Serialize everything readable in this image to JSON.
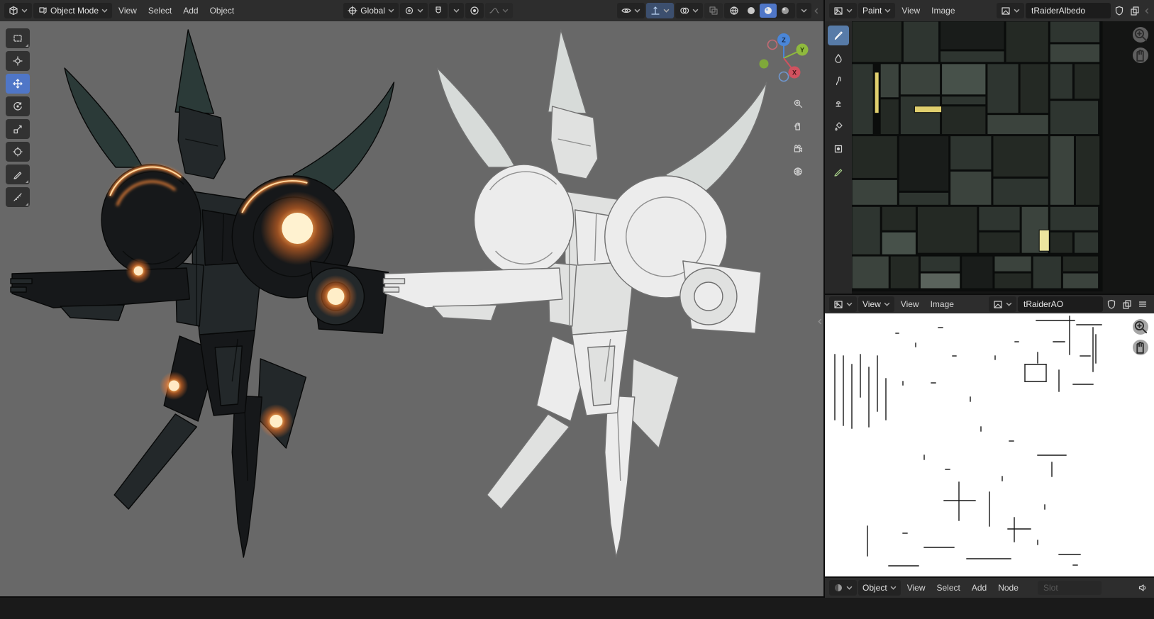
{
  "viewport": {
    "mode": "Object Mode",
    "menus": [
      "View",
      "Select",
      "Add",
      "Object"
    ],
    "orientation": "Global",
    "axis": {
      "x": "X",
      "y": "Y",
      "z": "Z"
    }
  },
  "paint_editor": {
    "mode": "Paint",
    "menus": [
      "View",
      "Image"
    ],
    "image_name": "tRaiderAlbedo"
  },
  "ao_editor": {
    "mode": "View",
    "menus": [
      "View",
      "Image"
    ],
    "image_name": "tRaiderAO"
  },
  "shader_editor": {
    "mode": "Object",
    "menus": [
      "View",
      "Select",
      "Add",
      "Node"
    ],
    "slot_label": "Slot"
  },
  "colors": {
    "accent_blue": "#4f76c7",
    "glow_orange": "#ff8c3a",
    "viewport_bg": "#686868",
    "header_bg": "#2d2d2d",
    "texture_yellow": "#e0cf6e"
  },
  "texture_palette": [
    "#0e100f",
    "#242924",
    "#2e3530",
    "#3b433d",
    "#47514a",
    "#191c1a",
    "#e0cf6e",
    "#ece59e",
    "#5a635c",
    "#0b0b0b"
  ],
  "texture_blocks": [
    [
      0,
      0,
      70,
      58,
      1
    ],
    [
      72,
      0,
      50,
      58,
      2
    ],
    [
      124,
      0,
      90,
      40,
      5
    ],
    [
      124,
      42,
      90,
      16,
      2
    ],
    [
      216,
      0,
      60,
      58,
      1
    ],
    [
      278,
      0,
      70,
      30,
      2
    ],
    [
      278,
      32,
      70,
      26,
      3
    ],
    [
      0,
      60,
      30,
      100,
      2
    ],
    [
      32,
      72,
      6,
      58,
      6
    ],
    [
      40,
      60,
      26,
      48,
      3
    ],
    [
      40,
      110,
      26,
      50,
      1
    ],
    [
      68,
      60,
      56,
      44,
      3
    ],
    [
      68,
      106,
      56,
      54,
      2
    ],
    [
      126,
      60,
      62,
      44,
      4
    ],
    [
      126,
      106,
      62,
      12,
      2
    ],
    [
      88,
      120,
      56,
      9,
      6
    ],
    [
      126,
      120,
      62,
      40,
      1
    ],
    [
      190,
      60,
      44,
      70,
      2
    ],
    [
      236,
      60,
      40,
      70,
      1
    ],
    [
      190,
      132,
      86,
      28,
      3
    ],
    [
      278,
      60,
      32,
      50,
      2
    ],
    [
      312,
      60,
      36,
      50,
      1
    ],
    [
      278,
      112,
      68,
      48,
      2
    ],
    [
      0,
      162,
      64,
      60,
      1
    ],
    [
      0,
      224,
      64,
      36,
      3
    ],
    [
      66,
      162,
      70,
      78,
      5
    ],
    [
      66,
      242,
      70,
      18,
      2
    ],
    [
      138,
      162,
      58,
      48,
      2
    ],
    [
      138,
      212,
      58,
      48,
      3
    ],
    [
      198,
      162,
      78,
      58,
      1
    ],
    [
      198,
      222,
      78,
      38,
      2
    ],
    [
      278,
      162,
      34,
      98,
      3
    ],
    [
      314,
      162,
      34,
      98,
      1
    ],
    [
      0,
      262,
      40,
      68,
      2
    ],
    [
      42,
      262,
      48,
      34,
      1
    ],
    [
      42,
      298,
      48,
      32,
      4
    ],
    [
      92,
      262,
      84,
      66,
      1
    ],
    [
      178,
      262,
      58,
      34,
      2
    ],
    [
      178,
      298,
      58,
      30,
      1
    ],
    [
      238,
      262,
      38,
      66,
      3
    ],
    [
      263,
      295,
      14,
      30,
      7
    ],
    [
      278,
      262,
      68,
      34,
      2
    ],
    [
      278,
      298,
      32,
      30,
      1
    ],
    [
      312,
      298,
      34,
      30,
      2
    ],
    [
      0,
      332,
      52,
      46,
      3
    ],
    [
      54,
      332,
      40,
      46,
      1
    ],
    [
      96,
      332,
      56,
      22,
      2
    ],
    [
      96,
      356,
      56,
      22,
      8
    ],
    [
      154,
      332,
      44,
      46,
      5
    ],
    [
      200,
      332,
      52,
      22,
      3
    ],
    [
      200,
      356,
      52,
      22,
      1
    ],
    [
      254,
      332,
      40,
      46,
      2
    ],
    [
      296,
      332,
      50,
      22,
      1
    ],
    [
      296,
      356,
      50,
      22,
      3
    ]
  ],
  "ao_lines": [
    [
      14,
      58,
      14,
      150
    ],
    [
      26,
      60,
      26,
      158
    ],
    [
      38,
      72,
      38,
      162
    ],
    [
      50,
      58,
      50,
      118
    ],
    [
      62,
      76,
      62,
      160
    ],
    [
      74,
      60,
      74,
      138
    ],
    [
      86,
      92,
      86,
      150
    ],
    [
      100,
      28,
      104,
      28
    ],
    [
      128,
      42,
      128,
      47
    ],
    [
      160,
      20,
      166,
      20
    ],
    [
      110,
      96,
      110,
      101
    ],
    [
      150,
      98,
      156,
      98
    ],
    [
      205,
      118,
      205,
      124
    ],
    [
      240,
      60,
      240,
      65
    ],
    [
      180,
      60,
      185,
      60
    ],
    [
      298,
      10,
      352,
      10
    ],
    [
      345,
      4,
      345,
      58
    ],
    [
      355,
      16,
      390,
      16
    ],
    [
      378,
      20,
      378,
      82
    ],
    [
      282,
      72,
      312,
      72
    ],
    [
      282,
      72,
      282,
      96
    ],
    [
      312,
      72,
      312,
      96
    ],
    [
      282,
      96,
      312,
      96
    ],
    [
      330,
      80,
      330,
      110
    ],
    [
      350,
      100,
      378,
      100
    ],
    [
      322,
      40,
      338,
      40
    ],
    [
      268,
      40,
      273,
      40
    ],
    [
      360,
      60,
      374,
      60
    ],
    [
      382,
      30,
      382,
      70
    ],
    [
      300,
      55,
      300,
      70
    ],
    [
      220,
      160,
      220,
      166
    ],
    [
      260,
      180,
      266,
      180
    ],
    [
      300,
      200,
      340,
      200
    ],
    [
      320,
      210,
      320,
      230
    ],
    [
      250,
      230,
      250,
      236
    ],
    [
      140,
      200,
      140,
      206
    ],
    [
      170,
      220,
      176,
      220
    ],
    [
      189,
      238,
      189,
      292
    ],
    [
      168,
      264,
      212,
      264
    ],
    [
      232,
      252,
      232,
      300
    ],
    [
      258,
      304,
      290,
      304
    ],
    [
      267,
      288,
      267,
      322
    ],
    [
      310,
      270,
      310,
      276
    ],
    [
      140,
      330,
      182,
      330
    ],
    [
      200,
      346,
      262,
      346
    ],
    [
      90,
      356,
      132,
      356
    ],
    [
      60,
      300,
      60,
      342
    ],
    [
      330,
      340,
      360,
      340
    ],
    [
      300,
      320,
      300,
      326
    ],
    [
      110,
      310,
      116,
      310
    ],
    [
      350,
      355,
      356,
      355
    ]
  ]
}
